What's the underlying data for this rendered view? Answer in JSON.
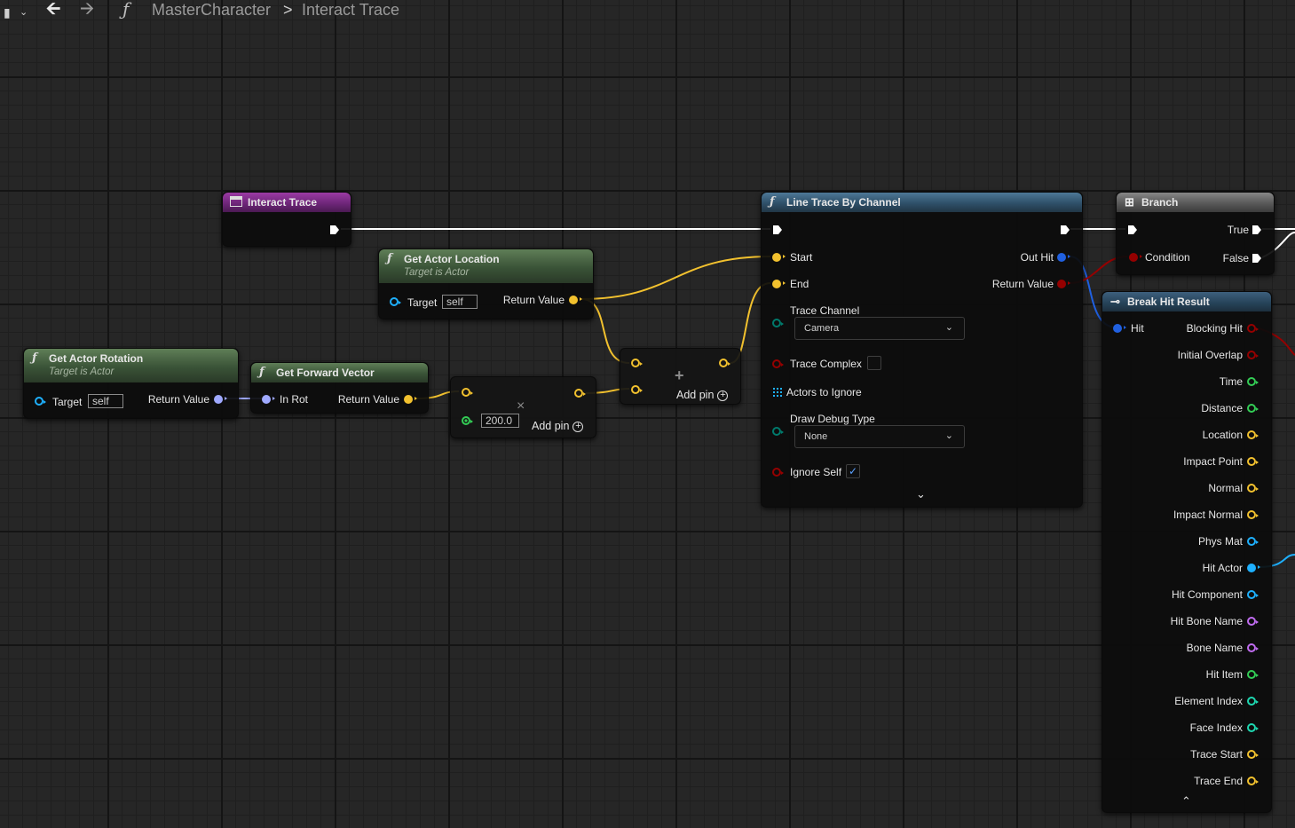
{
  "toolbar": {
    "function_glyph": "ƒ",
    "breadcrumb_parent": "MasterCharacter",
    "breadcrumb_separator": ">",
    "breadcrumb_current": "Interact Trace"
  },
  "colors": {
    "exec": "#ffffff",
    "vector": "#f2c12e",
    "rotator": "#9fa9ff",
    "object": "#1eb0ff",
    "struct": "#2060e0",
    "bool": "#950000",
    "float": "#33cc55",
    "name": "#c06cf0",
    "byte": "#007a6c",
    "int": "#1ed7b0"
  },
  "nodes": {
    "interact_trace": {
      "title": "Interact Trace"
    },
    "get_actor_location": {
      "title": "Get Actor Location",
      "subtitle": "Target is Actor",
      "target_label": "Target",
      "target_value": "self",
      "return_label": "Return Value"
    },
    "get_actor_rotation": {
      "title": "Get Actor Rotation",
      "subtitle": "Target is Actor",
      "target_label": "Target",
      "target_value": "self",
      "return_label": "Return Value"
    },
    "get_forward_vector": {
      "title": "Get Forward Vector",
      "in_label": "In Rot",
      "return_label": "Return Value"
    },
    "multiply": {
      "op_symbol": "×",
      "value": "200.0",
      "add_pin": "Add pin",
      "add_symbol": "+"
    },
    "add": {
      "op_symbol": "+",
      "add_pin": "Add pin",
      "add_symbol": "+"
    },
    "line_trace": {
      "title": "Line Trace By Channel",
      "start": "Start",
      "end": "End",
      "out_hit": "Out Hit",
      "return_value": "Return Value",
      "trace_channel": "Trace Channel",
      "trace_channel_value": "Camera",
      "trace_complex": "Trace Complex",
      "actors_to_ignore": "Actors to Ignore",
      "draw_debug_type": "Draw Debug Type",
      "draw_debug_value": "None",
      "ignore_self": "Ignore Self",
      "check": "✓"
    },
    "branch": {
      "title": "Branch",
      "true_label": "True",
      "condition": "Condition",
      "false_label": "False"
    },
    "break_hit": {
      "title": "Break Hit Result",
      "hit": "Hit",
      "outputs": [
        "Blocking Hit",
        "Initial Overlap",
        "Time",
        "Distance",
        "Location",
        "Impact Point",
        "Normal",
        "Impact Normal",
        "Phys Mat",
        "Hit Actor",
        "Hit Component",
        "Hit Bone Name",
        "Bone Name",
        "Hit Item",
        "Element Index",
        "Face Index",
        "Trace Start",
        "Trace End"
      ]
    }
  }
}
